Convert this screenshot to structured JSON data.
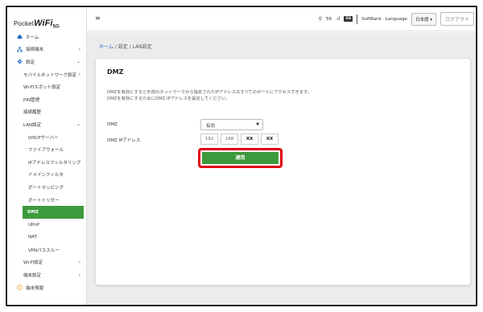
{
  "brand": {
    "pocket": "Pocket",
    "wifi": "WiFi",
    "gen": "5G"
  },
  "header": {
    "status_number": "56",
    "badge_5g": "5G",
    "carrier": "SoftBank",
    "language_label": "Language",
    "language_value": "日本語",
    "logout_label": "ログアウト"
  },
  "sidebar": {
    "home": "ホーム",
    "devices": "接続端末",
    "settings": "設定",
    "mobile_network": "モバイルネットワーク設定",
    "wifi_spot": "Wi-Fiスポット設定",
    "pin": "PIN管理",
    "connection_history": "接続履歴",
    "lan": "LAN設定",
    "dhcp": "DHCPサーバー",
    "firewall": "ファイアウォール",
    "ip_filter": "IPアドレスフィルタリング",
    "domain_filter": "ドメインフィルタ",
    "port_mapping": "ポートマッピング",
    "port_trigger": "ポートトリガー",
    "dmz": "DMZ",
    "upnp": "UPnP",
    "nat": "NAT",
    "vpn": "VPNパススルー",
    "wifi_settings": "Wi-Fi設定",
    "device_settings": "端末設定",
    "device_info": "端末情報"
  },
  "breadcrumb": {
    "home": "ホーム",
    "sep1": " / ",
    "settings": "設定",
    "sep2": " / ",
    "lan": "LAN設定"
  },
  "card": {
    "title": "DMZ",
    "desc_line1": "DMZを有効にすると外部のネットワークから指定されたIPアドレスのすべてのポートにアクセスできます。",
    "desc_line2": "DMZを有効にするためにDMZ IPアドレスを設定してください。",
    "dmz_label": "DMZ",
    "dmz_value": "有効",
    "ip_label": "DMZ IPアドレス",
    "ip": [
      "192",
      "168",
      "XX",
      "XX"
    ],
    "apply_label": "適用"
  },
  "colors": {
    "accent": "#3d9a3d",
    "highlight": "#e00010",
    "link": "#2a6fc9"
  }
}
